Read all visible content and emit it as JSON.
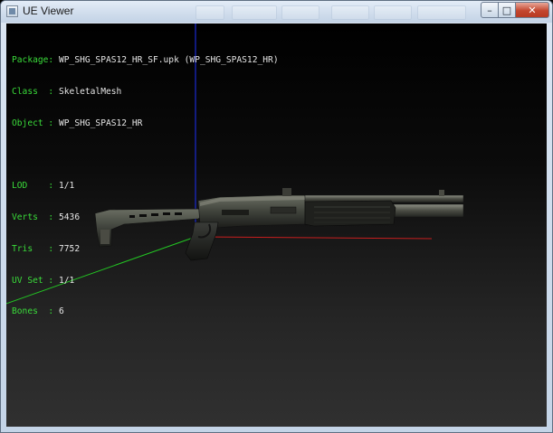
{
  "window": {
    "title": "UE Viewer",
    "minimize_glyph": "–",
    "maximize_glyph": "□",
    "close_glyph": "✕"
  },
  "info": {
    "package": {
      "label": "Package:",
      "value": "WP_SHG_SPAS12_HR_SF.upk (WP_SHG_SPAS12_HR)"
    },
    "class": {
      "label": "Class  :",
      "value": "SkeletalMesh"
    },
    "object": {
      "label": "Object :",
      "value": "WP_SHG_SPAS12_HR"
    },
    "lod": {
      "label": "LOD    :",
      "value": "1/1"
    },
    "verts": {
      "label": "Verts  :",
      "value": "5436"
    },
    "tris": {
      "label": "Tris   :",
      "value": "7752"
    },
    "uvset": {
      "label": "UV Set :",
      "value": "1/1"
    },
    "bones": {
      "label": "Bones  :",
      "value": "6"
    }
  },
  "axes": {
    "x_color": "#c81e1e",
    "y_color": "#23c623",
    "z_color": "#1a2ad0"
  },
  "icons": {
    "app": "app-icon",
    "minimize": "minimize-icon",
    "maximize": "maximize-icon",
    "close": "close-icon"
  }
}
